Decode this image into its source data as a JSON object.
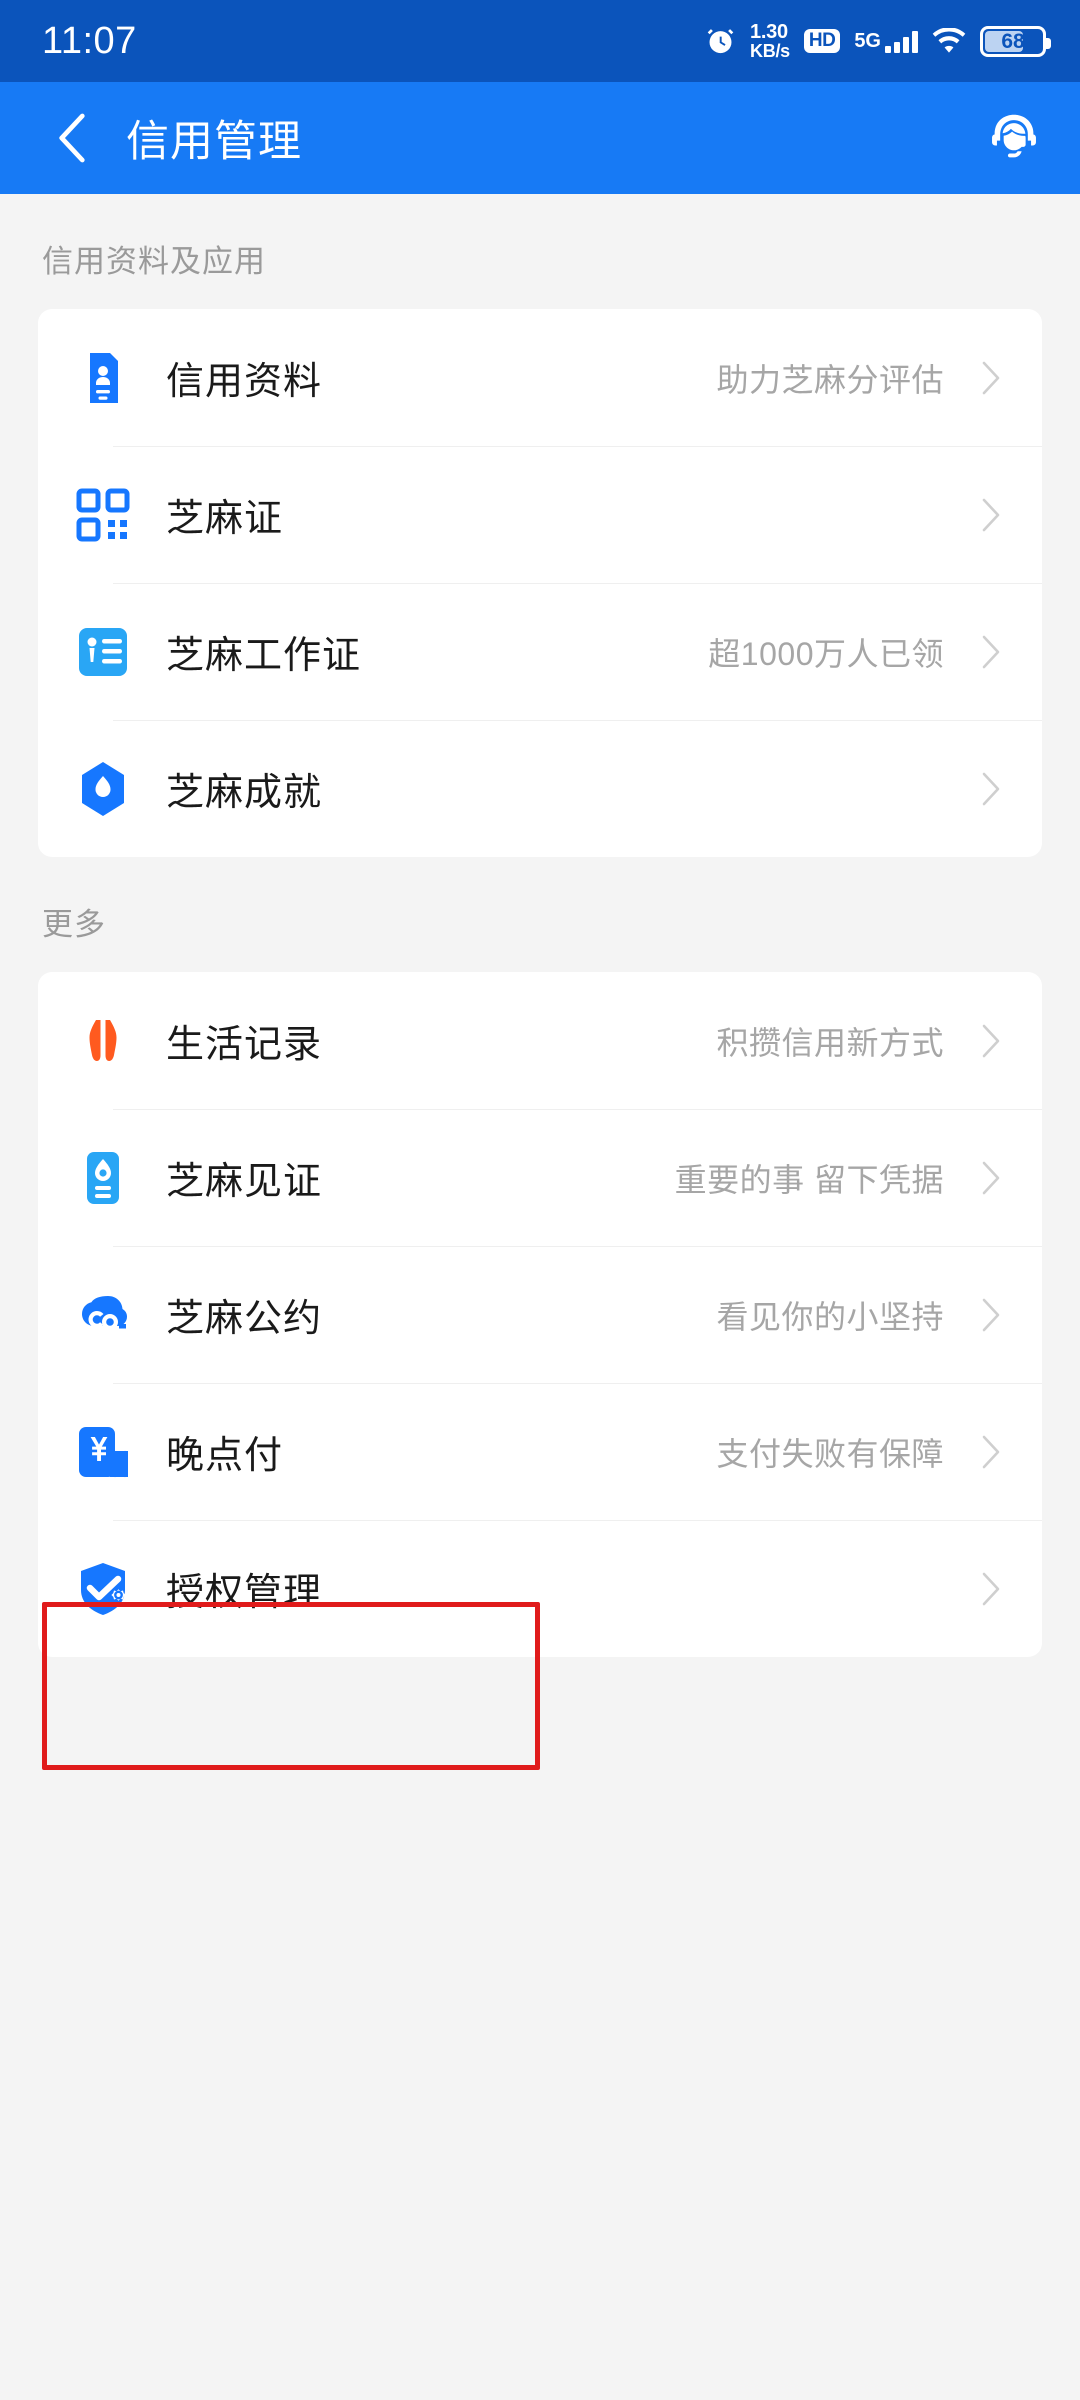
{
  "statusbar": {
    "clock": "11:07",
    "alarm_icon": "alarm-clock-icon",
    "netspeed_value": "1.30",
    "netspeed_unit": "KB/s",
    "hd_label": "HD",
    "network_type": "5G",
    "signal_icon": "signal-bars-icon",
    "wifi_icon": "wifi-icon",
    "battery_level": "68",
    "bar_bg": "#0b54bb"
  },
  "appbar": {
    "back_icon": "back-chevron-icon",
    "title": "信用管理",
    "service_icon": "customer-service-icon",
    "bg": "#177af5"
  },
  "sections": [
    {
      "title": "信用资料及应用",
      "rows": [
        {
          "icon": "id-card-icon",
          "icon_color": "#1677ff",
          "label": "信用资料",
          "sub": "助力芝麻分评估",
          "chevron": "chevron-right-icon"
        },
        {
          "icon": "qr-code-icon",
          "icon_color": "#1677ff",
          "label": "芝麻证",
          "sub": "",
          "chevron": "chevron-right-icon"
        },
        {
          "icon": "work-badge-icon",
          "icon_color": "#29a6f5",
          "label": "芝麻工作证",
          "sub": "超1000万人已领",
          "chevron": "chevron-right-icon"
        },
        {
          "icon": "achievement-icon",
          "icon_color": "#1677ff",
          "label": "芝麻成就",
          "sub": "",
          "chevron": "chevron-right-icon"
        }
      ]
    },
    {
      "title": "更多",
      "rows": [
        {
          "icon": "life-record-icon",
          "icon_color": "#ff5a1f",
          "label": "生活记录",
          "sub": "积攒信用新方式",
          "chevron": "chevron-right-icon"
        },
        {
          "icon": "witness-icon",
          "icon_color": "#29a6f5",
          "label": "芝麻见证",
          "sub": "重要的事 留下凭据",
          "chevron": "chevron-right-icon"
        },
        {
          "icon": "pact-icon",
          "icon_color": "#1677ff",
          "label": "芝麻公约",
          "sub": "看见你的小坚持",
          "chevron": "chevron-right-icon"
        },
        {
          "icon": "late-payment-icon",
          "icon_color": "#1677ff",
          "label": "晚点付",
          "sub": "支付失败有保障",
          "chevron": "chevron-right-icon"
        },
        {
          "icon": "authorization-shield-icon",
          "icon_color": "#1677ff",
          "label": "授权管理",
          "sub": "",
          "chevron": "chevron-right-icon"
        }
      ]
    }
  ],
  "annotation": {
    "name": "highlight-rectangle",
    "target_label": "授权管理",
    "color": "#e01b1b"
  }
}
